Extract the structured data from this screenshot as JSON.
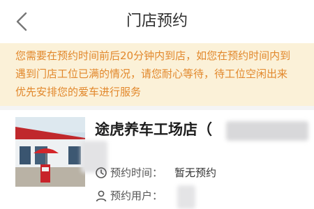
{
  "header": {
    "back_icon": "chevron-left-icon",
    "title": "门店预约"
  },
  "notice": {
    "line1": "您需要在预约时间前后20分钟内到店，如您在预约时间内到",
    "line2": "遇到门店工位已满的情况，请您耐心等待，待工位空闲出来",
    "line3": "优先安排您的爱车进行服务",
    "text_color": "#e2882c",
    "background": "#fbf1d8"
  },
  "store": {
    "name": "途虎养车工场店（",
    "photo_icon": "store-photo",
    "time_label": "预约时间：",
    "time_value": "暂无预约",
    "time_icon": "clock-icon",
    "user_label": "预约用户：",
    "user_icon": "user-icon"
  }
}
